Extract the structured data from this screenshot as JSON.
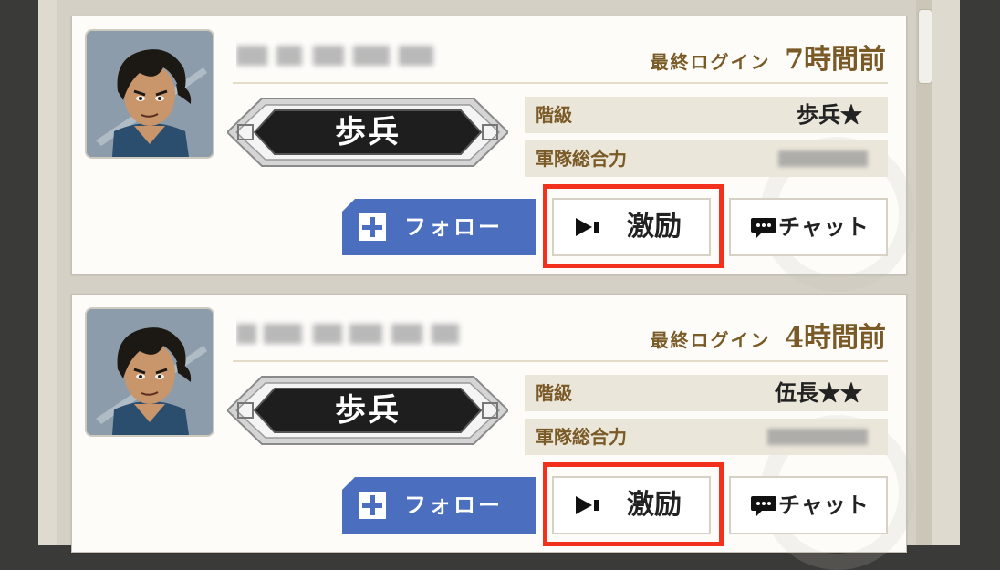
{
  "players": [
    {
      "last_login_label": "最終ログイン",
      "last_login_value": "7時間前",
      "rank_title": "歩兵",
      "rank_label": "階級",
      "rank_value": "歩兵★",
      "power_label": "軍隊総合力",
      "follow_label": "フォロー",
      "cheer_label": "激励",
      "chat_label": "チャット"
    },
    {
      "last_login_label": "最終ログイン",
      "last_login_value": "4時間前",
      "rank_title": "歩兵",
      "rank_label": "階級",
      "rank_value": "伍長★★",
      "power_label": "軍隊総合力",
      "follow_label": "フォロー",
      "cheer_label": "激励",
      "chat_label": "チャット"
    }
  ],
  "icons": {
    "follow": "plus-icon",
    "cheer": "megaphone-icon",
    "chat": "chat-bubble-icon"
  },
  "colors": {
    "accent_gold": "#7a5a26",
    "follow_blue": "#4b6fbe",
    "highlight_red": "#f2301c"
  }
}
